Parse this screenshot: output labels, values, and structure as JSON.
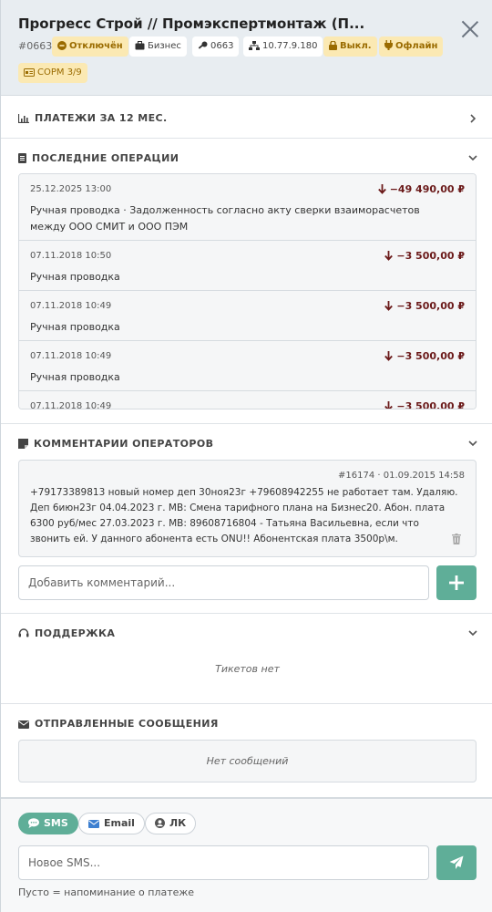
{
  "header": {
    "title": "Прогресс Строй // Промэкспертмонтаж (П...",
    "id": "#0663",
    "chips": {
      "status": "Отключён",
      "tariff": "Бизнес",
      "login": "0663",
      "ip": "10.77.9.180",
      "lock": "Выкл.",
      "online": "Офлайн",
      "sorm": "СОРМ 3/9"
    }
  },
  "sections": {
    "payments": "ПЛАТЕЖИ ЗА 12 МЕС.",
    "operations": "ПОСЛЕДНИЕ ОПЕРАЦИИ",
    "comments": "КОММЕНТАРИИ ОПЕРАТОРОВ",
    "support": "ПОДДЕРЖКА",
    "messages": "ОТПРАВЛЕННЫЕ СООБЩЕНИЯ"
  },
  "operations": [
    {
      "date": "25.12.2025 13:00",
      "amount": "−49 490,00 ₽",
      "desc": "Ручная проводка · Задолженность согласно акту сверки взаиморасчетов между ООО СМИТ и ООО ПЭМ"
    },
    {
      "date": "07.11.2018 10:50",
      "amount": "−3 500,00 ₽",
      "desc": "Ручная проводка"
    },
    {
      "date": "07.11.2018 10:49",
      "amount": "−3 500,00 ₽",
      "desc": "Ручная проводка"
    },
    {
      "date": "07.11.2018 10:49",
      "amount": "−3 500,00 ₽",
      "desc": "Ручная проводка"
    },
    {
      "date": "07.11.2018 10:49",
      "amount": "−3 500,00 ₽",
      "desc": ""
    }
  ],
  "comment": {
    "meta": "#16174 · 01.09.2015 14:58",
    "text": "+79173389813 новый номер деп 30ноя23г +79608942255 не работает там. Удаляю. Деп 6июн23г 04.04.2023 г. МВ: Смена тарифного плана на Бизнес20. Абон. плата 6300 руб/мес 27.03.2023 г. МВ: 89608716804 - Татьяна Васильевна, если что звонить ей. У данного абонента есть ONU!! Абонентская плата 3500р\\м."
  },
  "comment_input": {
    "placeholder": "Добавить комментарий..."
  },
  "support": {
    "empty": "Тикетов нет"
  },
  "messages": {
    "empty": "Нет сообщений"
  },
  "channels": {
    "sms": "SMS",
    "email": "Email",
    "lk": "ЛК"
  },
  "sms_input": {
    "placeholder": "Новое SMS..."
  },
  "hint": "Пусто = напоминание о платеже"
}
